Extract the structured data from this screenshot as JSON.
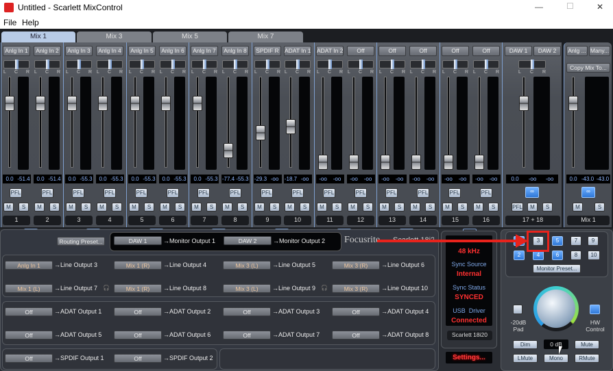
{
  "window": {
    "title": "Untitled - Scarlett MixControl",
    "minimize": "—",
    "maximize": "☐",
    "close": "✕"
  },
  "menu": [
    "File",
    "Help"
  ],
  "tabs": [
    {
      "label": "Mix 1",
      "active": true
    },
    {
      "label": "Mix 3"
    },
    {
      "label": "Mix 5"
    },
    {
      "label": "Mix 7"
    }
  ],
  "channels": [
    {
      "source": "Anlg In 1",
      "fader": "0.0",
      "meter": "-51.4",
      "number": "1"
    },
    {
      "source": "Anlg In 2",
      "fader": "0.0",
      "meter": "-51.4",
      "number": "2"
    },
    {
      "source": "Anlg In 3",
      "fader": "0.0",
      "meter": "-55.3",
      "number": "3"
    },
    {
      "source": "Anlg In 4",
      "fader": "0.0",
      "meter": "-55.3",
      "number": "4"
    },
    {
      "source": "Anlg In 5",
      "fader": "0.0",
      "meter": "-55.3",
      "number": "5"
    },
    {
      "source": "Anlg In 6",
      "fader": "0.0",
      "meter": "-55.3",
      "number": "6"
    },
    {
      "source": "Anlg In 7",
      "fader": "0.0",
      "meter": "-55.3",
      "number": "7"
    },
    {
      "source": "Anlg In 8",
      "fader": "-77.4",
      "meter": "-55.3",
      "number": "8"
    },
    {
      "source": "SPDIF R",
      "fader": "-29.3",
      "meter": "-oo",
      "number": "9"
    },
    {
      "source": "ADAT In 1",
      "fader": "-18.7",
      "meter": "-oo",
      "number": "10"
    },
    {
      "source": "ADAT In 2",
      "fader": "-oo",
      "meter": "-oo",
      "number": "11"
    },
    {
      "source": "Off",
      "fader": "-oo",
      "meter": "-oo",
      "number": "12"
    },
    {
      "source": "Off",
      "fader": "-oo",
      "meter": "-oo",
      "number": "13"
    },
    {
      "source": "Off",
      "fader": "-oo",
      "meter": "-oo",
      "number": "14"
    },
    {
      "source": "Off",
      "fader": "-oo",
      "meter": "-oo",
      "number": "15"
    },
    {
      "source": "Off",
      "fader": "-oo",
      "meter": "-oo",
      "number": "16"
    }
  ],
  "strip_labels": {
    "pfl": "PFL",
    "mute": "M",
    "solo": "S",
    "pan_l": "L",
    "pan_c": "C",
    "pan_r": "R"
  },
  "daw": {
    "sources": [
      "DAW 1",
      "DAW 2"
    ],
    "fader": "0.0",
    "meters": [
      "-oo",
      "-oo"
    ],
    "number": "17 + 18"
  },
  "master": {
    "sources": [
      "Anlg ...",
      "Many..."
    ],
    "copy_mix": "Copy Mix To...",
    "fader": "0.0",
    "meters": [
      "-43.0",
      "-43.0"
    ],
    "number": "Mix 1"
  },
  "routing": {
    "preset": "Routing Preset...",
    "monitor": [
      {
        "src": "DAW 1",
        "dst": "→Monitor Output 1"
      },
      {
        "src": "DAW 2",
        "dst": "→Monitor Output 2"
      }
    ],
    "logo": "Focusrite",
    "logo2": "Scarlett 18i20",
    "line": [
      {
        "src": "Anlg In 1",
        "dst": "→Line Output 3"
      },
      {
        "src": "Mix 1 (R)",
        "dst": "→Line Output 4"
      },
      {
        "src": "Mix 3 (L)",
        "dst": "→Line Output 5"
      },
      {
        "src": "Mix 3 (R)",
        "dst": "→Line Output 6"
      },
      {
        "src": "Mix 1 (L)",
        "dst": "→Line Output 7"
      },
      {
        "src": "Mix 1 (R)",
        "dst": "→Line Output 8"
      },
      {
        "src": "Mix 3 (L)",
        "dst": "→Line Output 9"
      },
      {
        "src": "Mix 3 (R)",
        "dst": "→Line Output 10"
      }
    ],
    "adat": [
      {
        "src": "Off",
        "dst": "→ADAT Output 1"
      },
      {
        "src": "Off",
        "dst": "→ADAT Output 2"
      },
      {
        "src": "Off",
        "dst": "→ADAT Output 3"
      },
      {
        "src": "Off",
        "dst": "→ADAT Output 4"
      },
      {
        "src": "Off",
        "dst": "→ADAT Output 5"
      },
      {
        "src": "Off",
        "dst": "→ADAT Output 6"
      },
      {
        "src": "Off",
        "dst": "→ADAT Output 7"
      },
      {
        "src": "Off",
        "dst": "→ADAT Output 8"
      }
    ],
    "spdif": [
      {
        "src": "Off",
        "dst": "→SPDIF Output 1"
      },
      {
        "src": "Off",
        "dst": "→SPDIF Output 2"
      }
    ]
  },
  "sync": {
    "sample_rate": "48 kHz",
    "sync_source_label": "Sync Source",
    "sync_source": "Internal",
    "sync_status_label": "Sync Status",
    "sync_status": "SYNCED",
    "usb_label": "USB  Driver",
    "usb": "Connected",
    "device": "Scarlett 18i20",
    "settings": "Settings..."
  },
  "monitor": {
    "buttons": [
      {
        "label": "3",
        "active": false
      },
      {
        "label": "5",
        "active": true
      },
      {
        "label": "7",
        "active": false
      },
      {
        "label": "9",
        "active": false
      },
      {
        "label": "2",
        "active": true
      },
      {
        "label": "4",
        "active": true
      },
      {
        "label": "6",
        "active": true
      },
      {
        "label": "8",
        "active": false
      },
      {
        "label": "10",
        "active": false
      }
    ],
    "preset": "Monitor Preset...",
    "pad": "-20dB Pad",
    "hw": "HW Control",
    "dim": "Dim",
    "level": "0 dB",
    "mute": "Mute",
    "lmute": "LMute",
    "mono": "Mono",
    "rmute": "RMute"
  },
  "colors": {
    "accent": "#3a86ff",
    "alert": "#ff2a2a",
    "highlight": "#e8231c"
  }
}
